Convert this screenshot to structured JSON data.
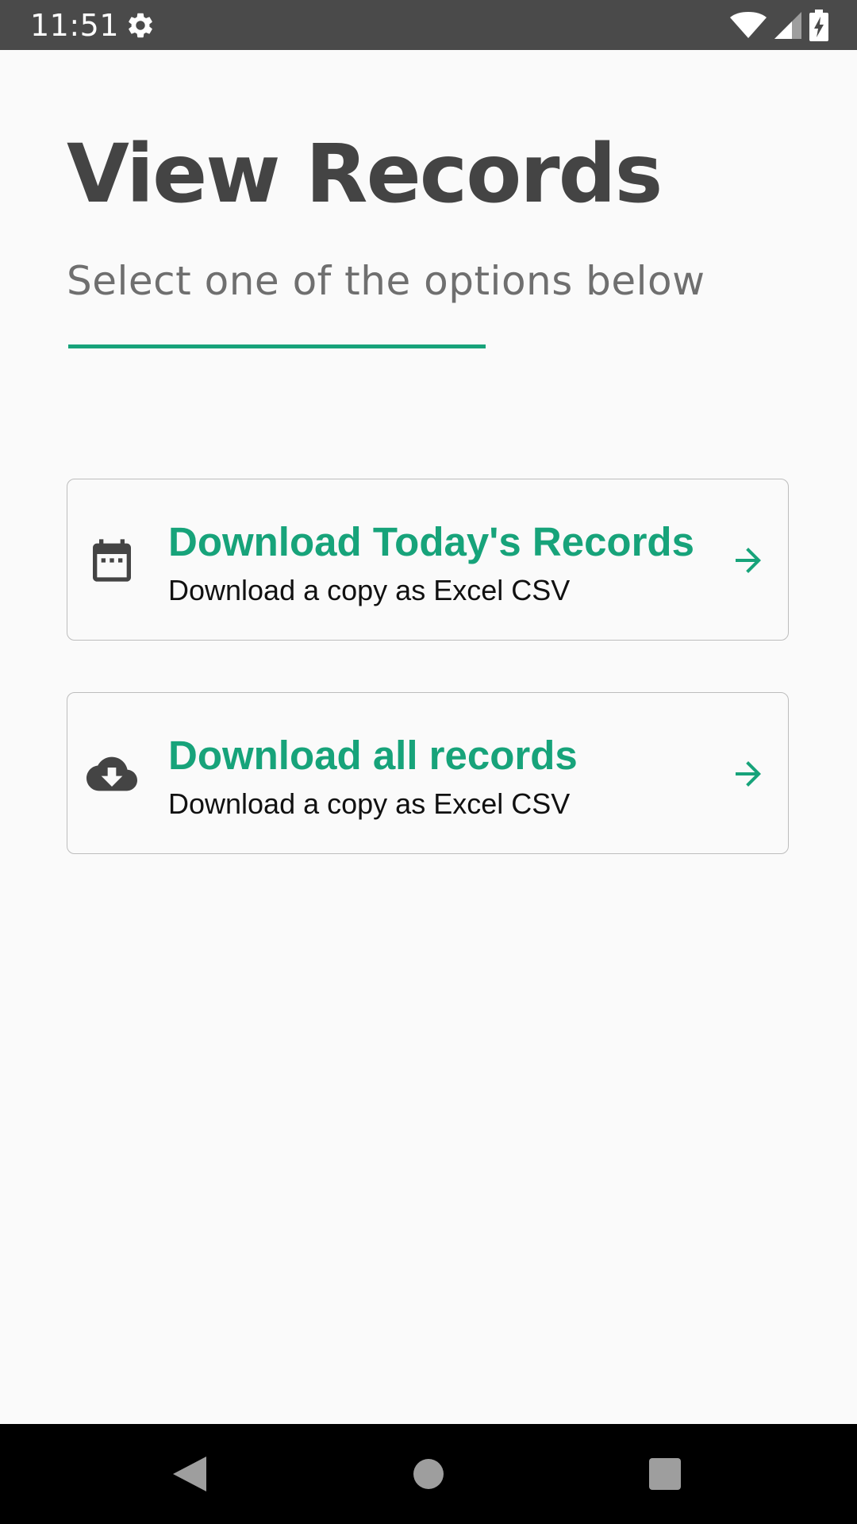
{
  "status_bar": {
    "time": "11:51",
    "icons": [
      "gear-icon",
      "wifi-icon",
      "signal-icon",
      "battery-charging-icon"
    ]
  },
  "header": {
    "title": "View Records",
    "subtitle": "Select one of the options below"
  },
  "options": [
    {
      "icon": "calendar-icon",
      "title": "Download Today's Records",
      "description": "Download a copy as Excel CSV",
      "action_icon": "arrow-right-icon"
    },
    {
      "icon": "cloud-download-icon",
      "title": "Download all records",
      "description": "Download a copy as Excel CSV",
      "action_icon": "arrow-right-icon"
    }
  ],
  "nav_bar": {
    "buttons": [
      "back-icon",
      "home-icon",
      "recents-icon"
    ]
  },
  "colors": {
    "accent": "#17a37a",
    "title_text": "#444444",
    "subtitle_text": "#6f6f6f",
    "status_bar": "#4a4a4a",
    "background": "#fafafa"
  }
}
